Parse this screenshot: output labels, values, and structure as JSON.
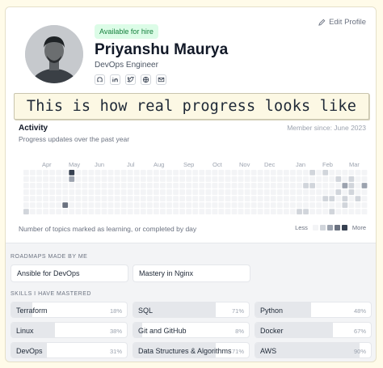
{
  "header": {
    "edit_profile_label": "Edit Profile",
    "hire_badge": "Available for hire",
    "name": "Priyanshu Maurya",
    "role": "DevOps Engineer",
    "social_icons": [
      "github-icon",
      "linkedin-icon",
      "twitter-icon",
      "globe-icon",
      "mail-icon"
    ]
  },
  "banner_text": "This is how real progress looks like",
  "activity": {
    "title": "Activity",
    "subtitle": "Progress updates over the past year",
    "member_since": "Member since: June 2023",
    "months": [
      "Apr",
      "May",
      "Jun",
      "Jul",
      "Aug",
      "Sep",
      "Oct",
      "Nov",
      "Dec",
      "Jan",
      "Feb",
      "Mar"
    ],
    "footnote": "Number of topics marked as learning, or completed by day",
    "legend_less": "Less",
    "legend_more": "More",
    "levels": [
      "#f3f4f6",
      "#d1d5db",
      "#9ca3af",
      "#6b7280",
      "#374151"
    ]
  },
  "roadmaps": {
    "label": "ROADMAPS MADE BY ME",
    "items": [
      "Ansible for DevOps",
      "Mastery in Nginx"
    ]
  },
  "skills": {
    "label": "SKILLS I HAVE MASTERED",
    "items": [
      {
        "name": "Terraform",
        "percent": "18%",
        "value": 18
      },
      {
        "name": "SQL",
        "percent": "71%",
        "value": 71
      },
      {
        "name": "Python",
        "percent": "48%",
        "value": 48
      },
      {
        "name": "Linux",
        "percent": "38%",
        "value": 38
      },
      {
        "name": "Git and GitHub",
        "percent": "8%",
        "value": 8
      },
      {
        "name": "Docker",
        "percent": "67%",
        "value": 67
      },
      {
        "name": "DevOps",
        "percent": "31%",
        "value": 31
      },
      {
        "name": "Data Structures & Algorithms",
        "percent": "71%",
        "value": 71
      },
      {
        "name": "AWS",
        "percent": "90%",
        "value": 90
      }
    ]
  }
}
